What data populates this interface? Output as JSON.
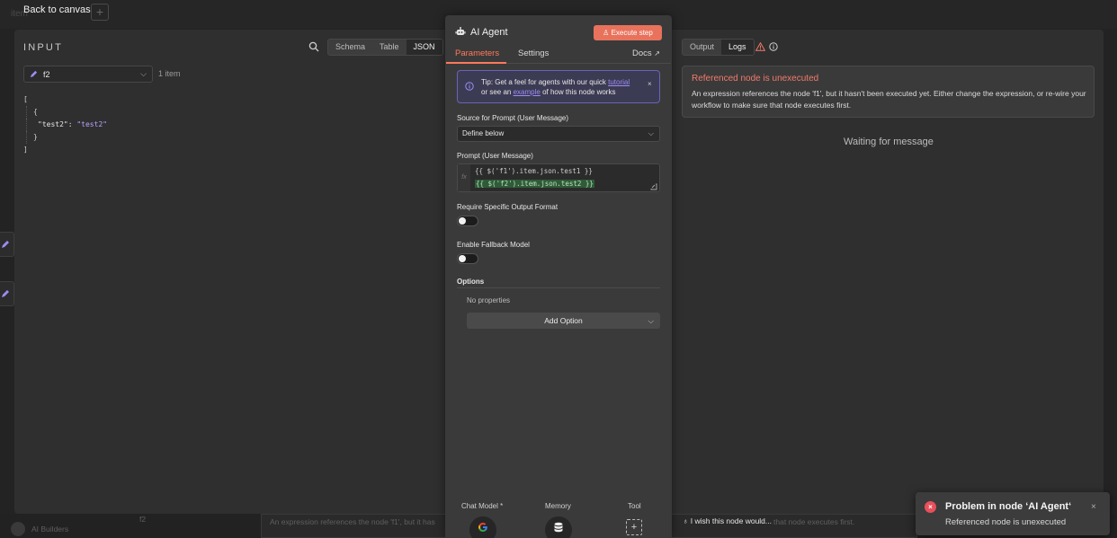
{
  "canvas": {
    "back_label": "Back to canvas",
    "ghost_label": "item",
    "plus": "+"
  },
  "input_panel": {
    "title": "INPUT",
    "views": [
      "Schema",
      "Table",
      "JSON"
    ],
    "active_view": "JSON",
    "node_select": "f2",
    "item_count": "1 item",
    "json_lines": {
      "l1": "[",
      "l2": "{",
      "key": "\"test2\":",
      "value": "\"test2\"",
      "l4": "}",
      "l5": "]"
    }
  },
  "node_panel": {
    "title": "AI Agent",
    "execute_label": "Execute step",
    "tabs": {
      "parameters": "Parameters",
      "settings": "Settings",
      "docs": "Docs"
    },
    "tip": {
      "prefix": "Tip: Get a feel for agents with our quick",
      "link1": "tutorial",
      "middle": "or see an",
      "link2": "example",
      "suffix": "of how this node works",
      "close": "×"
    },
    "source_label": "Source for Prompt (User Message)",
    "source_value": "Define below",
    "prompt_label": "Prompt (User Message)",
    "fx": "fx",
    "expr1": "{{ $('f1').item.json.test1 }}",
    "expr2": "{{ $('f2').item.json.test2 }}",
    "output_format_label": "Require Specific Output Format",
    "fallback_label": "Enable Fallback Model",
    "options_label": "Options",
    "no_properties": "No properties",
    "add_option": "Add Option",
    "sub_nodes": {
      "chat_model": "Chat Model *",
      "memory": "Memory",
      "tool": "Tool"
    }
  },
  "output_panel": {
    "views": [
      "Output",
      "Logs"
    ],
    "active_view": "Logs",
    "error_title": "Referenced node is unexecuted",
    "error_text": "An expression references the node 'f1', but it hasn't been executed yet. Either change the expression, or re-wire your workflow to make sure that node executes first.",
    "waiting": "Waiting for message"
  },
  "bottom": {
    "org": "AI Builders",
    "ghost_node": "f2",
    "ghost_message": "An expression references the node 'f1', but it has",
    "ghost_message_tail": "that node executes first.",
    "feedback": "I wish this node would..."
  },
  "toast": {
    "title": "Problem in node ‘AI Agent‘",
    "text": "Referenced node is unexecuted",
    "close": "×"
  },
  "colors": {
    "accent": "#ff7a5c",
    "execute": "#e8725c",
    "error": "#f27a6b",
    "tip_border": "#6b62b8"
  }
}
